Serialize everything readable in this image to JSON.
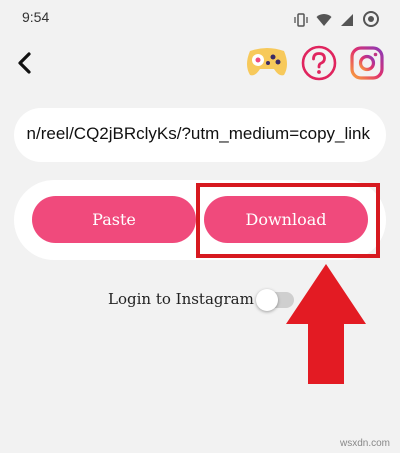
{
  "status_bar": {
    "time": "9:54"
  },
  "header": {
    "back_icon": "back-arrow-icon",
    "icons": [
      "gamepad-icon",
      "help-icon",
      "instagram-icon"
    ]
  },
  "url_field": {
    "value": "n/reel/CQ2jBRclyKs/?utm_medium=copy_link"
  },
  "actions": {
    "paste_label": "Paste",
    "download_label": "Download"
  },
  "login": {
    "label": "Login to Instagram",
    "toggle_on": false
  },
  "annotation": {
    "highlight_color": "#d71920",
    "arrow_color": "#e31b23"
  },
  "colors": {
    "accent": "#f04a7c",
    "background": "#f2f2f2"
  },
  "watermark": "wsxdn.com"
}
